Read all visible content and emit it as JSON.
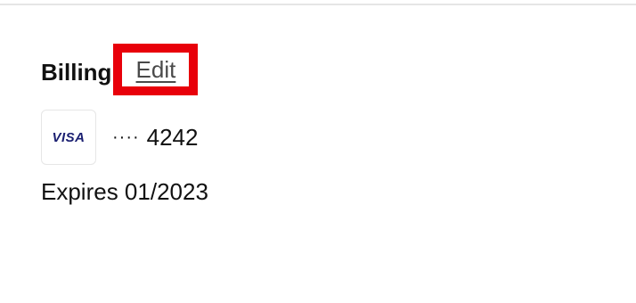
{
  "billing": {
    "title": "Billing",
    "edit_label": "Edit",
    "highlight_color": "#e8000a"
  },
  "card": {
    "brand": "VISA",
    "brand_icon": "visa-logo-icon",
    "masked_dots": "····",
    "last4": "4242",
    "expiry_text": "Expires 01/2023"
  }
}
